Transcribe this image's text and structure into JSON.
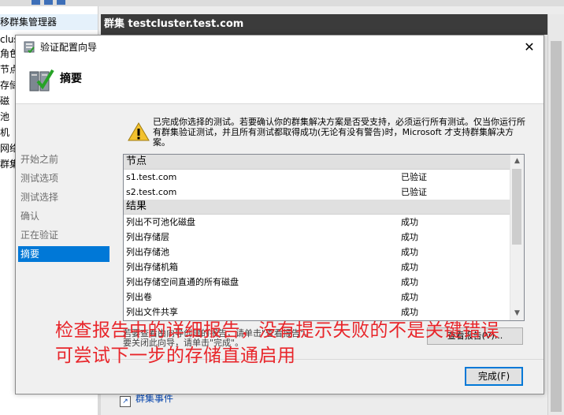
{
  "background": {
    "tree_items": [
      "移群集管理器",
      "clus",
      "角色",
      "节点",
      "存储",
      "磁",
      "池",
      "机",
      "网络",
      "群集"
    ],
    "cluster_header": "群集 testcluster.test.com",
    "cluster_events_link": "群集事件"
  },
  "dialog": {
    "title": "验证配置向导",
    "close_icon": "close-icon",
    "page_title": "摘要",
    "steps": [
      "开始之前",
      "测试选项",
      "测试选择",
      "确认",
      "正在验证",
      "摘要"
    ],
    "active_step": "摘要",
    "message": "已完成你选择的测试。若要确认你的群集解决方案是否受支持，必须运行所有测试。仅当你运行所有群集验证测试，并且所有测试都取得成功(无论有没有警告)时，Microsoft 才支持群集解决方案。",
    "results": {
      "sections": [
        {
          "header": "节点",
          "rows": [
            {
              "name": "s1.test.com",
              "result": "已验证"
            },
            {
              "name": "s2.test.com",
              "result": "已验证"
            }
          ]
        },
        {
          "header": "结果",
          "rows": [
            {
              "name": "列出不可池化磁盘",
              "result": "成功"
            },
            {
              "name": "列出存储层",
              "result": "成功"
            },
            {
              "name": "列出存储池",
              "result": "成功"
            },
            {
              "name": "列出存储机箱",
              "result": "成功"
            },
            {
              "name": "列出存储空间直通的所有磁盘",
              "result": "成功"
            },
            {
              "name": "列出卷",
              "result": "成功"
            },
            {
              "name": "列出文件共享",
              "result": "成功"
            }
          ]
        }
      ]
    },
    "report_note_line1": "若要查看由向导创建的报告，请单击\"查看报告\"。",
    "report_note_line2": "要关闭此向导，请单击\"完成\"。",
    "view_report_button": "查看报告(V)...",
    "finish_button": "完成(F)"
  },
  "annotation": {
    "line1": "检查报告中的详细报告，没有提示失败的不是关键错误",
    "line2": "可尝试下一步的存储直通启用"
  },
  "colors": {
    "accent": "#0078d7",
    "annotation": "#e8252a",
    "header_dark": "#3b3b3b"
  }
}
